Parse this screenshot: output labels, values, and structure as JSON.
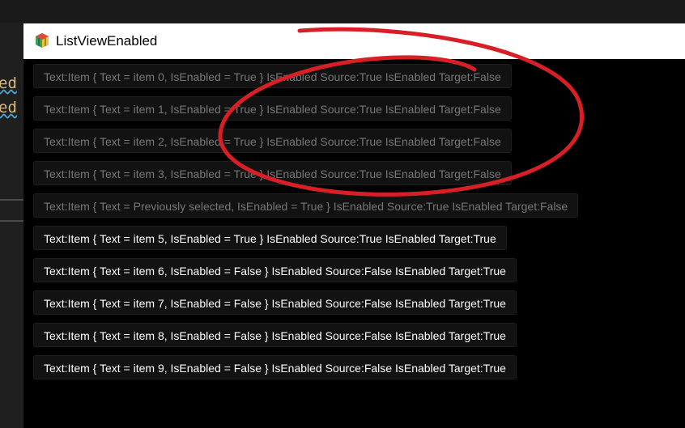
{
  "background_editor": {
    "code_tokens": [
      "ed",
      "ed"
    ]
  },
  "window": {
    "title": "ListViewEnabled",
    "icon": "app-icon"
  },
  "list": {
    "items": [
      {
        "label": "Text:Item { Text = item 0, IsEnabled = True }  IsEnabled Source:True  IsEnabled Target:False",
        "enabled": false
      },
      {
        "label": "Text:Item { Text = item 1, IsEnabled = True }  IsEnabled Source:True  IsEnabled Target:False",
        "enabled": false
      },
      {
        "label": "Text:Item { Text = item 2, IsEnabled = True }  IsEnabled Source:True  IsEnabled Target:False",
        "enabled": false
      },
      {
        "label": "Text:Item { Text = item 3, IsEnabled = True }  IsEnabled Source:True  IsEnabled Target:False",
        "enabled": false
      },
      {
        "label": "Text:Item { Text = Previously selected, IsEnabled = True }  IsEnabled Source:True  IsEnabled Target:False",
        "enabled": false
      },
      {
        "label": "Text:Item { Text = item 5, IsEnabled = True }  IsEnabled Source:True  IsEnabled Target:True",
        "enabled": true
      },
      {
        "label": "Text:Item { Text = item 6, IsEnabled = False }  IsEnabled Source:False  IsEnabled Target:True",
        "enabled": true
      },
      {
        "label": "Text:Item { Text = item 7, IsEnabled = False }  IsEnabled Source:False  IsEnabled Target:True",
        "enabled": true
      },
      {
        "label": "Text:Item { Text = item 8, IsEnabled = False }  IsEnabled Source:False  IsEnabled Target:True",
        "enabled": true
      },
      {
        "label": "Text:Item { Text = item 9, IsEnabled = False }  IsEnabled Source:False  IsEnabled Target:True",
        "enabled": true
      }
    ]
  },
  "colors": {
    "annotation_stroke": "#d81f26",
    "disabled_text": "#777777",
    "enabled_text": "#ffffff"
  }
}
